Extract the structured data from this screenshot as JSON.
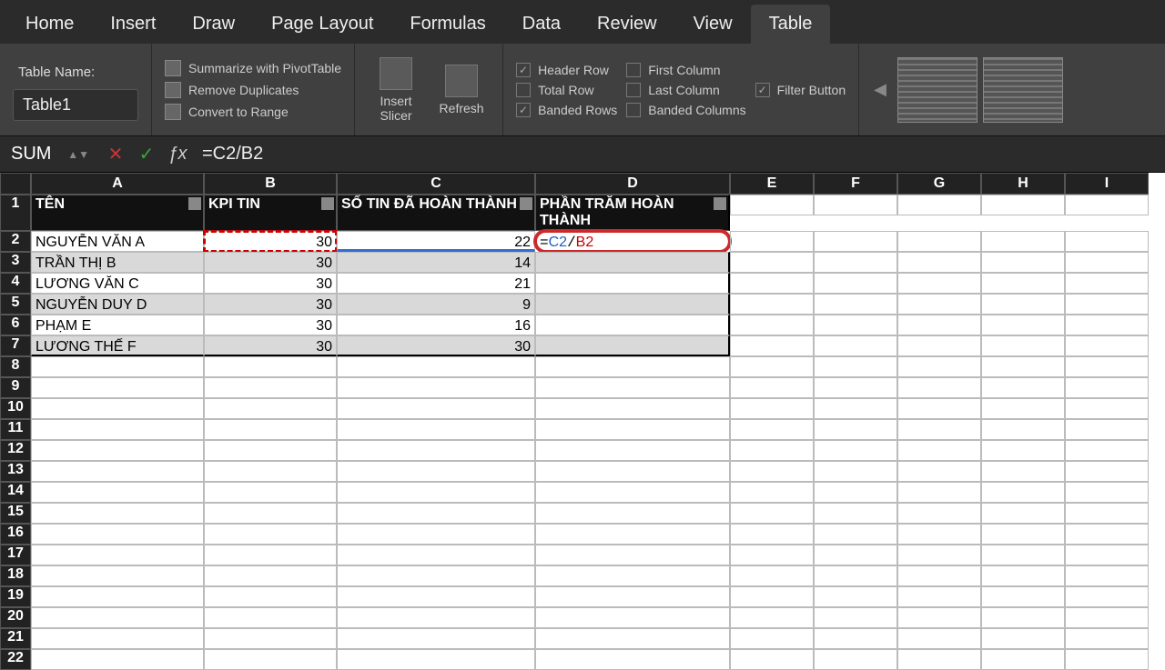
{
  "tabs": [
    "Home",
    "Insert",
    "Draw",
    "Page Layout",
    "Formulas",
    "Data",
    "Review",
    "View",
    "Table"
  ],
  "active_tab": "Table",
  "table_name_label": "Table Name:",
  "table_name_value": "Table1",
  "tools": {
    "pivot": "Summarize with PivotTable",
    "dedup": "Remove Duplicates",
    "convert": "Convert to Range",
    "slicer": "Insert Slicer",
    "refresh": "Refresh"
  },
  "options": {
    "header_row": "Header Row",
    "total_row": "Total Row",
    "banded_rows": "Banded Rows",
    "first_column": "First Column",
    "last_column": "Last Column",
    "banded_columns": "Banded Columns",
    "filter_button": "Filter Button"
  },
  "checked": {
    "header_row": true,
    "banded_rows": true,
    "filter_button": true
  },
  "name_box": "SUM",
  "formula": "=C2/B2",
  "columns": [
    "A",
    "B",
    "C",
    "D",
    "E",
    "F",
    "G",
    "H",
    "I"
  ],
  "headers": [
    "TÊN",
    "KPI TIN",
    "SỐ TIN ĐÃ HOÀN THÀNH",
    "PHẦN TRĂM HOÀN THÀNH"
  ],
  "editing_cell_display": "=C2/B2",
  "chart_data": {
    "type": "table",
    "columns": [
      "TÊN",
      "KPI TIN",
      "SỐ TIN ĐÃ HOÀN THÀNH",
      "PHẦN TRĂM HOÀN THÀNH"
    ],
    "rows": [
      {
        "ten": "NGUYỄN VĂN A",
        "kpi": 30,
        "done": 22,
        "pct": "=C2/B2"
      },
      {
        "ten": "TRẦN THỊ B",
        "kpi": 30,
        "done": 14,
        "pct": ""
      },
      {
        "ten": "LƯƠNG VĂN C",
        "kpi": 30,
        "done": 21,
        "pct": ""
      },
      {
        "ten": "NGUYỄN DUY D",
        "kpi": 30,
        "done": 9,
        "pct": ""
      },
      {
        "ten": "PHẠM E",
        "kpi": 30,
        "done": 16,
        "pct": ""
      },
      {
        "ten": "LƯƠNG THẾ F",
        "kpi": 30,
        "done": 30,
        "pct": ""
      }
    ]
  }
}
